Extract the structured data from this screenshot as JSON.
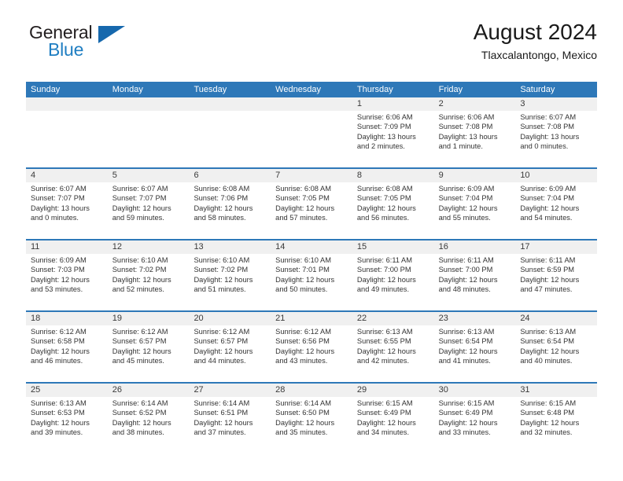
{
  "brand": {
    "word_one": "General",
    "word_two": "Blue",
    "triangle_icon": "brand-triangle-icon"
  },
  "header": {
    "title": "August 2024",
    "subtitle": "Tlaxcalantongo, Mexico"
  },
  "colors": {
    "header_blue": "#2E78B8",
    "number_band": "#F0F0F0",
    "brand_blue": "#1F7EC2",
    "text": "#333333"
  },
  "weekday_headers": [
    "Sunday",
    "Monday",
    "Tuesday",
    "Wednesday",
    "Thursday",
    "Friday",
    "Saturday"
  ],
  "weeks": [
    {
      "days": [
        {
          "num": "",
          "lines": []
        },
        {
          "num": "",
          "lines": []
        },
        {
          "num": "",
          "lines": []
        },
        {
          "num": "",
          "lines": []
        },
        {
          "num": "1",
          "lines": [
            "Sunrise: 6:06 AM",
            "Sunset: 7:09 PM",
            "Daylight: 13 hours",
            "and 2 minutes."
          ]
        },
        {
          "num": "2",
          "lines": [
            "Sunrise: 6:06 AM",
            "Sunset: 7:08 PM",
            "Daylight: 13 hours",
            "and 1 minute."
          ]
        },
        {
          "num": "3",
          "lines": [
            "Sunrise: 6:07 AM",
            "Sunset: 7:08 PM",
            "Daylight: 13 hours",
            "and 0 minutes."
          ]
        }
      ]
    },
    {
      "days": [
        {
          "num": "4",
          "lines": [
            "Sunrise: 6:07 AM",
            "Sunset: 7:07 PM",
            "Daylight: 13 hours",
            "and 0 minutes."
          ]
        },
        {
          "num": "5",
          "lines": [
            "Sunrise: 6:07 AM",
            "Sunset: 7:07 PM",
            "Daylight: 12 hours",
            "and 59 minutes."
          ]
        },
        {
          "num": "6",
          "lines": [
            "Sunrise: 6:08 AM",
            "Sunset: 7:06 PM",
            "Daylight: 12 hours",
            "and 58 minutes."
          ]
        },
        {
          "num": "7",
          "lines": [
            "Sunrise: 6:08 AM",
            "Sunset: 7:05 PM",
            "Daylight: 12 hours",
            "and 57 minutes."
          ]
        },
        {
          "num": "8",
          "lines": [
            "Sunrise: 6:08 AM",
            "Sunset: 7:05 PM",
            "Daylight: 12 hours",
            "and 56 minutes."
          ]
        },
        {
          "num": "9",
          "lines": [
            "Sunrise: 6:09 AM",
            "Sunset: 7:04 PM",
            "Daylight: 12 hours",
            "and 55 minutes."
          ]
        },
        {
          "num": "10",
          "lines": [
            "Sunrise: 6:09 AM",
            "Sunset: 7:04 PM",
            "Daylight: 12 hours",
            "and 54 minutes."
          ]
        }
      ]
    },
    {
      "days": [
        {
          "num": "11",
          "lines": [
            "Sunrise: 6:09 AM",
            "Sunset: 7:03 PM",
            "Daylight: 12 hours",
            "and 53 minutes."
          ]
        },
        {
          "num": "12",
          "lines": [
            "Sunrise: 6:10 AM",
            "Sunset: 7:02 PM",
            "Daylight: 12 hours",
            "and 52 minutes."
          ]
        },
        {
          "num": "13",
          "lines": [
            "Sunrise: 6:10 AM",
            "Sunset: 7:02 PM",
            "Daylight: 12 hours",
            "and 51 minutes."
          ]
        },
        {
          "num": "14",
          "lines": [
            "Sunrise: 6:10 AM",
            "Sunset: 7:01 PM",
            "Daylight: 12 hours",
            "and 50 minutes."
          ]
        },
        {
          "num": "15",
          "lines": [
            "Sunrise: 6:11 AM",
            "Sunset: 7:00 PM",
            "Daylight: 12 hours",
            "and 49 minutes."
          ]
        },
        {
          "num": "16",
          "lines": [
            "Sunrise: 6:11 AM",
            "Sunset: 7:00 PM",
            "Daylight: 12 hours",
            "and 48 minutes."
          ]
        },
        {
          "num": "17",
          "lines": [
            "Sunrise: 6:11 AM",
            "Sunset: 6:59 PM",
            "Daylight: 12 hours",
            "and 47 minutes."
          ]
        }
      ]
    },
    {
      "days": [
        {
          "num": "18",
          "lines": [
            "Sunrise: 6:12 AM",
            "Sunset: 6:58 PM",
            "Daylight: 12 hours",
            "and 46 minutes."
          ]
        },
        {
          "num": "19",
          "lines": [
            "Sunrise: 6:12 AM",
            "Sunset: 6:57 PM",
            "Daylight: 12 hours",
            "and 45 minutes."
          ]
        },
        {
          "num": "20",
          "lines": [
            "Sunrise: 6:12 AM",
            "Sunset: 6:57 PM",
            "Daylight: 12 hours",
            "and 44 minutes."
          ]
        },
        {
          "num": "21",
          "lines": [
            "Sunrise: 6:12 AM",
            "Sunset: 6:56 PM",
            "Daylight: 12 hours",
            "and 43 minutes."
          ]
        },
        {
          "num": "22",
          "lines": [
            "Sunrise: 6:13 AM",
            "Sunset: 6:55 PM",
            "Daylight: 12 hours",
            "and 42 minutes."
          ]
        },
        {
          "num": "23",
          "lines": [
            "Sunrise: 6:13 AM",
            "Sunset: 6:54 PM",
            "Daylight: 12 hours",
            "and 41 minutes."
          ]
        },
        {
          "num": "24",
          "lines": [
            "Sunrise: 6:13 AM",
            "Sunset: 6:54 PM",
            "Daylight: 12 hours",
            "and 40 minutes."
          ]
        }
      ]
    },
    {
      "days": [
        {
          "num": "25",
          "lines": [
            "Sunrise: 6:13 AM",
            "Sunset: 6:53 PM",
            "Daylight: 12 hours",
            "and 39 minutes."
          ]
        },
        {
          "num": "26",
          "lines": [
            "Sunrise: 6:14 AM",
            "Sunset: 6:52 PM",
            "Daylight: 12 hours",
            "and 38 minutes."
          ]
        },
        {
          "num": "27",
          "lines": [
            "Sunrise: 6:14 AM",
            "Sunset: 6:51 PM",
            "Daylight: 12 hours",
            "and 37 minutes."
          ]
        },
        {
          "num": "28",
          "lines": [
            "Sunrise: 6:14 AM",
            "Sunset: 6:50 PM",
            "Daylight: 12 hours",
            "and 35 minutes."
          ]
        },
        {
          "num": "29",
          "lines": [
            "Sunrise: 6:15 AM",
            "Sunset: 6:49 PM",
            "Daylight: 12 hours",
            "and 34 minutes."
          ]
        },
        {
          "num": "30",
          "lines": [
            "Sunrise: 6:15 AM",
            "Sunset: 6:49 PM",
            "Daylight: 12 hours",
            "and 33 minutes."
          ]
        },
        {
          "num": "31",
          "lines": [
            "Sunrise: 6:15 AM",
            "Sunset: 6:48 PM",
            "Daylight: 12 hours",
            "and 32 minutes."
          ]
        }
      ]
    }
  ]
}
